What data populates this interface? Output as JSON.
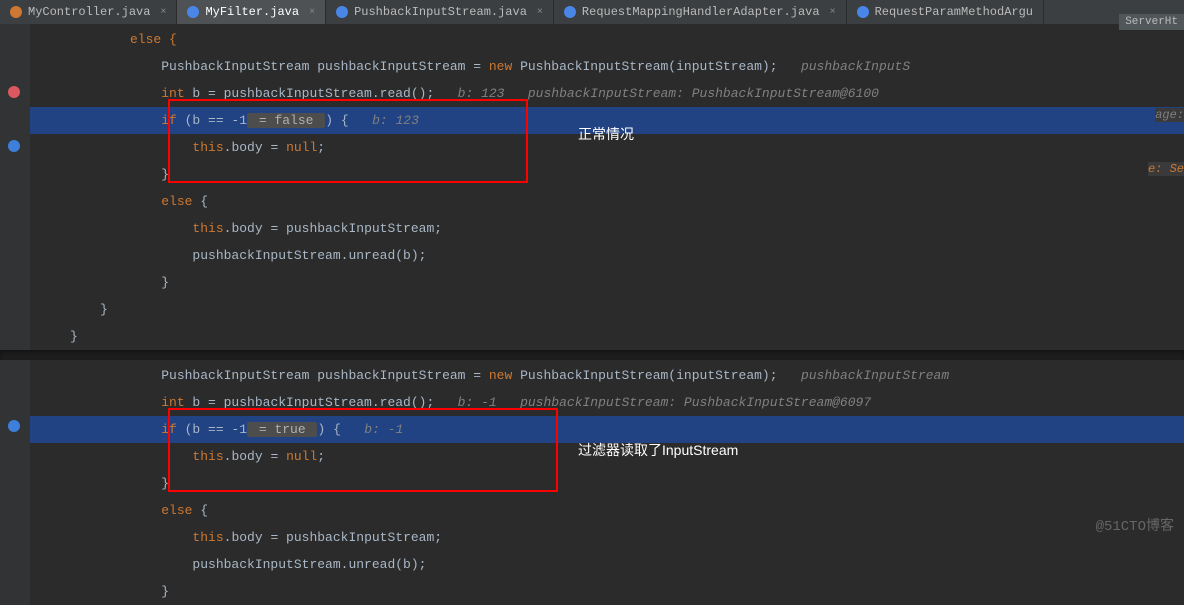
{
  "tabs": [
    {
      "label": "MyController.java",
      "active": false
    },
    {
      "label": "MyFilter.java",
      "active": true
    },
    {
      "label": "PushbackInputStream.java",
      "active": false
    },
    {
      "label": "RequestMappingHandlerAdapter.java",
      "active": false
    },
    {
      "label": "RequestParamMethodArgu",
      "active": false
    }
  ],
  "side_badge": "ServerHt",
  "side_hints": {
    "line1_right": "pushbackInputS",
    "line10_right": "pushbackInputStream",
    "age_hint": "age:",
    "e_hint": "e: Se"
  },
  "block1": {
    "line0": "}",
    "line0b": "else {",
    "line1a": "PushbackInputStream pushbackInputStream = ",
    "line1_new": "new",
    "line1b": " PushbackInputStream(inputStream);",
    "line2a": "int",
    "line2b": " b = pushbackInputStream.read();",
    "line2_hint": "b: 123   pushbackInputStream: PushbackInputStream@6100",
    "line3a": "if",
    "line3b": " (b == -1",
    "line3_hint": " = false ",
    "line3c": ") {",
    "line3_inline": "b: 123",
    "line4a": "this",
    "line4b": ".body = ",
    "line4_null": "null",
    "line4c": ";",
    "line5": "}",
    "line6a": "else",
    "line6b": " {",
    "line7a": "this",
    "line7b": ".body = pushbackInputStream;",
    "line8": "pushbackInputStream.unread(b);",
    "line9": "}",
    "line10": "}",
    "line11": "}"
  },
  "annotation1": "正常情况",
  "block2": {
    "line1a": "PushbackInputStream pushbackInputStream = ",
    "line1_new": "new",
    "line1b": " PushbackInputStream(inputStream);",
    "line2a": "int",
    "line2b": " b = pushbackInputStream.read();",
    "line2_hint": "b: -1   pushbackInputStream: PushbackInputStream@6097",
    "line3a": "if",
    "line3b": " (b == -1",
    "line3_hint": " = true ",
    "line3c": ") {",
    "line3_inline": "b: -1",
    "line4a": "this",
    "line4b": ".body = ",
    "line4_null": "null",
    "line4c": ";",
    "line5": "}",
    "line6a": "else",
    "line6b": " {",
    "line7a": "this",
    "line7b": ".body = pushbackInputStream;",
    "line8": "pushbackInputStream.unread(b);",
    "line9": "}"
  },
  "annotation2": "过滤器读取了InputStream",
  "watermark": "@51CTO博客"
}
